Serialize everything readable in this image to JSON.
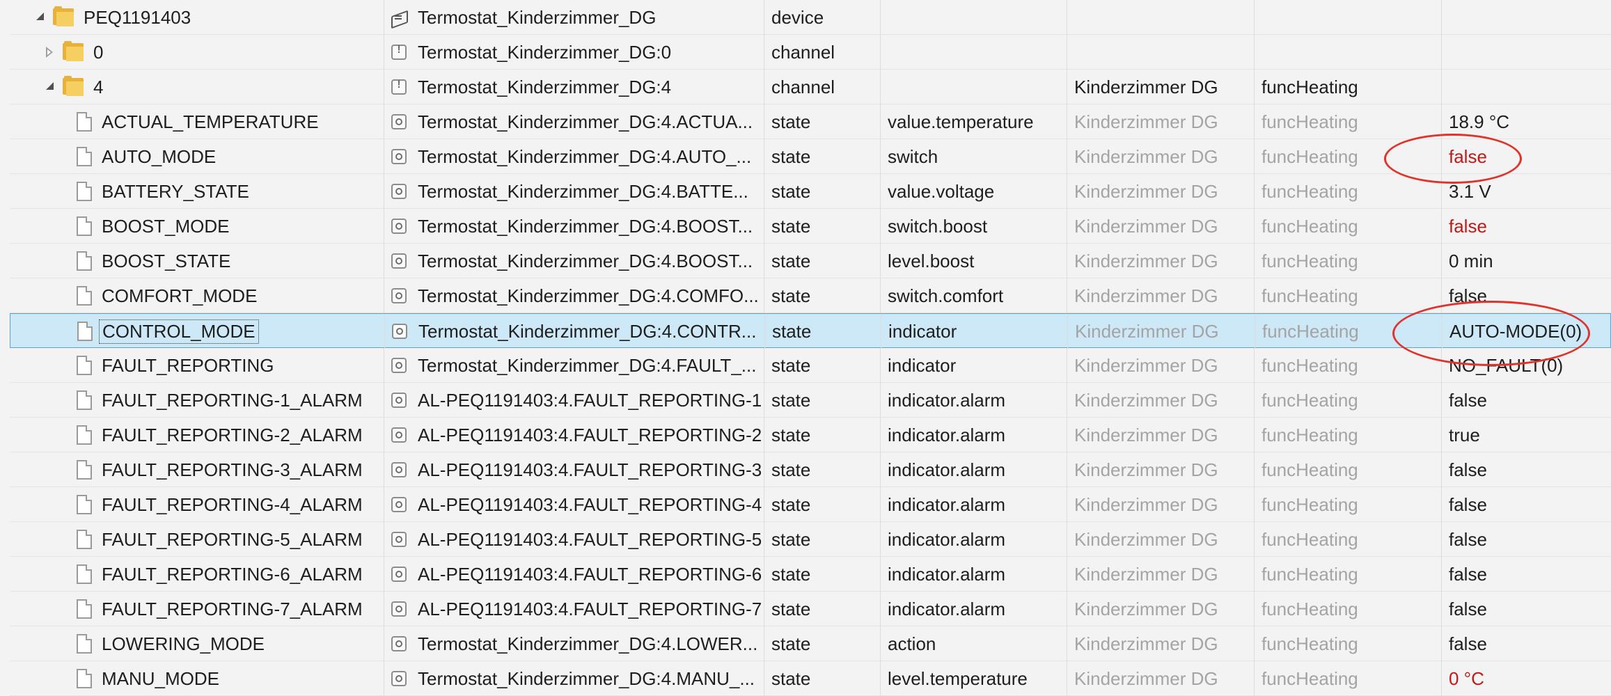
{
  "rows": [
    {
      "level": 0,
      "expander": "open",
      "icon": "folder",
      "name": "PEQ1191403",
      "type_icon": "device",
      "id": "Termostat_Kinderzimmer_DG",
      "type": "device",
      "role": "",
      "room": "",
      "func": "",
      "value": "",
      "muted": false,
      "value_red": false
    },
    {
      "level": 1,
      "expander": "closed",
      "icon": "folder",
      "name": "0",
      "type_icon": "channel",
      "id": "Termostat_Kinderzimmer_DG:0",
      "type": "channel",
      "role": "",
      "room": "",
      "func": "",
      "value": "",
      "muted": false,
      "value_red": false
    },
    {
      "level": 1,
      "expander": "open",
      "icon": "folder",
      "name": "4",
      "type_icon": "channel",
      "id": "Termostat_Kinderzimmer_DG:4",
      "type": "channel",
      "role": "",
      "room": "Kinderzimmer DG",
      "func": "funcHeating",
      "value": "",
      "muted": false,
      "value_red": false
    },
    {
      "level": 2,
      "icon": "file",
      "name": "ACTUAL_TEMPERATURE",
      "type_icon": "state",
      "id": "Termostat_Kinderzimmer_DG:4.ACTUA...",
      "type": "state",
      "role": "value.temperature",
      "room": "Kinderzimmer DG",
      "func": "funcHeating",
      "value": "18.9 °C",
      "muted": true,
      "value_red": false
    },
    {
      "level": 2,
      "icon": "file",
      "name": "AUTO_MODE",
      "type_icon": "state",
      "id": "Termostat_Kinderzimmer_DG:4.AUTO_...",
      "type": "state",
      "role": "switch",
      "room": "Kinderzimmer DG",
      "func": "funcHeating",
      "value": "false",
      "muted": true,
      "value_red": true
    },
    {
      "level": 2,
      "icon": "file",
      "name": "BATTERY_STATE",
      "type_icon": "state",
      "id": "Termostat_Kinderzimmer_DG:4.BATTE...",
      "type": "state",
      "role": "value.voltage",
      "room": "Kinderzimmer DG",
      "func": "funcHeating",
      "value": "3.1 V",
      "muted": true,
      "value_red": false
    },
    {
      "level": 2,
      "icon": "file",
      "name": "BOOST_MODE",
      "type_icon": "state",
      "id": "Termostat_Kinderzimmer_DG:4.BOOST...",
      "type": "state",
      "role": "switch.boost",
      "room": "Kinderzimmer DG",
      "func": "funcHeating",
      "value": "false",
      "muted": true,
      "value_red": true
    },
    {
      "level": 2,
      "icon": "file",
      "name": "BOOST_STATE",
      "type_icon": "state",
      "id": "Termostat_Kinderzimmer_DG:4.BOOST...",
      "type": "state",
      "role": "level.boost",
      "room": "Kinderzimmer DG",
      "func": "funcHeating",
      "value": "0 min",
      "muted": true,
      "value_red": false
    },
    {
      "level": 2,
      "icon": "file",
      "name": "COMFORT_MODE",
      "type_icon": "state",
      "id": "Termostat_Kinderzimmer_DG:4.COMFO...",
      "type": "state",
      "role": "switch.comfort",
      "room": "Kinderzimmer DG",
      "func": "funcHeating",
      "value": "false",
      "muted": true,
      "value_red": false
    },
    {
      "level": 2,
      "icon": "file",
      "name": "CONTROL_MODE",
      "type_icon": "state",
      "id": "Termostat_Kinderzimmer_DG:4.CONTR...",
      "type": "state",
      "role": "indicator",
      "room": "Kinderzimmer DG",
      "func": "funcHeating",
      "value": "AUTO-MODE(0)",
      "muted": true,
      "value_red": false,
      "selected": true
    },
    {
      "level": 2,
      "icon": "file",
      "name": "FAULT_REPORTING",
      "type_icon": "state",
      "id": "Termostat_Kinderzimmer_DG:4.FAULT_...",
      "type": "state",
      "role": "indicator",
      "room": "Kinderzimmer DG",
      "func": "funcHeating",
      "value": "NO_FAULT(0)",
      "muted": true,
      "value_red": false
    },
    {
      "level": 2,
      "icon": "file",
      "name": "FAULT_REPORTING-1_ALARM",
      "type_icon": "state",
      "id": "AL-PEQ1191403:4.FAULT_REPORTING-1",
      "type": "state",
      "role": "indicator.alarm",
      "room": "Kinderzimmer DG",
      "func": "funcHeating",
      "value": "false",
      "muted": true,
      "value_red": false
    },
    {
      "level": 2,
      "icon": "file",
      "name": "FAULT_REPORTING-2_ALARM",
      "type_icon": "state",
      "id": "AL-PEQ1191403:4.FAULT_REPORTING-2",
      "type": "state",
      "role": "indicator.alarm",
      "room": "Kinderzimmer DG",
      "func": "funcHeating",
      "value": "true",
      "muted": true,
      "value_red": false
    },
    {
      "level": 2,
      "icon": "file",
      "name": "FAULT_REPORTING-3_ALARM",
      "type_icon": "state",
      "id": "AL-PEQ1191403:4.FAULT_REPORTING-3",
      "type": "state",
      "role": "indicator.alarm",
      "room": "Kinderzimmer DG",
      "func": "funcHeating",
      "value": "false",
      "muted": true,
      "value_red": false
    },
    {
      "level": 2,
      "icon": "file",
      "name": "FAULT_REPORTING-4_ALARM",
      "type_icon": "state",
      "id": "AL-PEQ1191403:4.FAULT_REPORTING-4",
      "type": "state",
      "role": "indicator.alarm",
      "room": "Kinderzimmer DG",
      "func": "funcHeating",
      "value": "false",
      "muted": true,
      "value_red": false
    },
    {
      "level": 2,
      "icon": "file",
      "name": "FAULT_REPORTING-5_ALARM",
      "type_icon": "state",
      "id": "AL-PEQ1191403:4.FAULT_REPORTING-5",
      "type": "state",
      "role": "indicator.alarm",
      "room": "Kinderzimmer DG",
      "func": "funcHeating",
      "value": "false",
      "muted": true,
      "value_red": false
    },
    {
      "level": 2,
      "icon": "file",
      "name": "FAULT_REPORTING-6_ALARM",
      "type_icon": "state",
      "id": "AL-PEQ1191403:4.FAULT_REPORTING-6",
      "type": "state",
      "role": "indicator.alarm",
      "room": "Kinderzimmer DG",
      "func": "funcHeating",
      "value": "false",
      "muted": true,
      "value_red": false
    },
    {
      "level": 2,
      "icon": "file",
      "name": "FAULT_REPORTING-7_ALARM",
      "type_icon": "state",
      "id": "AL-PEQ1191403:4.FAULT_REPORTING-7",
      "type": "state",
      "role": "indicator.alarm",
      "room": "Kinderzimmer DG",
      "func": "funcHeating",
      "value": "false",
      "muted": true,
      "value_red": false
    },
    {
      "level": 2,
      "icon": "file",
      "name": "LOWERING_MODE",
      "type_icon": "state",
      "id": "Termostat_Kinderzimmer_DG:4.LOWER...",
      "type": "state",
      "role": "action",
      "room": "Kinderzimmer DG",
      "func": "funcHeating",
      "value": "false",
      "muted": true,
      "value_red": false
    },
    {
      "level": 2,
      "icon": "file",
      "name": "MANU_MODE",
      "type_icon": "state",
      "id": "Termostat_Kinderzimmer_DG:4.MANU_...",
      "type": "state",
      "role": "level.temperature",
      "room": "Kinderzimmer DG",
      "func": "funcHeating",
      "value": "0 °C",
      "muted": true,
      "value_red": true
    }
  ],
  "colors": {
    "annotation": "#e0332c",
    "value_red": "#c41818",
    "muted": "#a4a4a4",
    "selected_bg": "#cde8f6"
  }
}
